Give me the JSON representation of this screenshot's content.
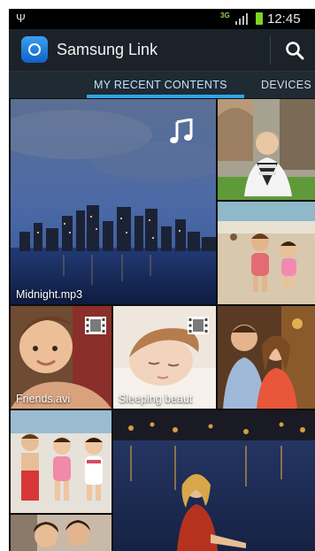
{
  "status_bar": {
    "network": "3G",
    "time": "12:45",
    "icons": [
      "usb-icon",
      "signal-icon",
      "battery-icon"
    ]
  },
  "app_bar": {
    "title": "Samsung Link",
    "icons": [
      "samsung-link-logo-icon",
      "search-icon"
    ]
  },
  "tabs": [
    {
      "label": "MY RECENT CONTENTS",
      "selected": true
    },
    {
      "label": "DEVICES",
      "selected": false
    }
  ],
  "items": [
    {
      "caption": "Midnight.mp3",
      "type": "music",
      "badge_icon": "music-note-icon"
    },
    {
      "caption": "",
      "type": "photo"
    },
    {
      "caption": "",
      "type": "photo"
    },
    {
      "caption": "Friends.avi",
      "type": "video",
      "badge_icon": "film-icon"
    },
    {
      "caption": "Sleeping beaut",
      "type": "video",
      "badge_icon": "film-icon"
    },
    {
      "caption": "",
      "type": "photo"
    },
    {
      "caption": "",
      "type": "photo"
    },
    {
      "caption": "",
      "type": "photo"
    },
    {
      "caption": "",
      "type": "photo"
    }
  ],
  "colors": {
    "accent": "#2ea6e9",
    "app_bar": "#1b2229",
    "tab_bar": "#1f2a33"
  }
}
